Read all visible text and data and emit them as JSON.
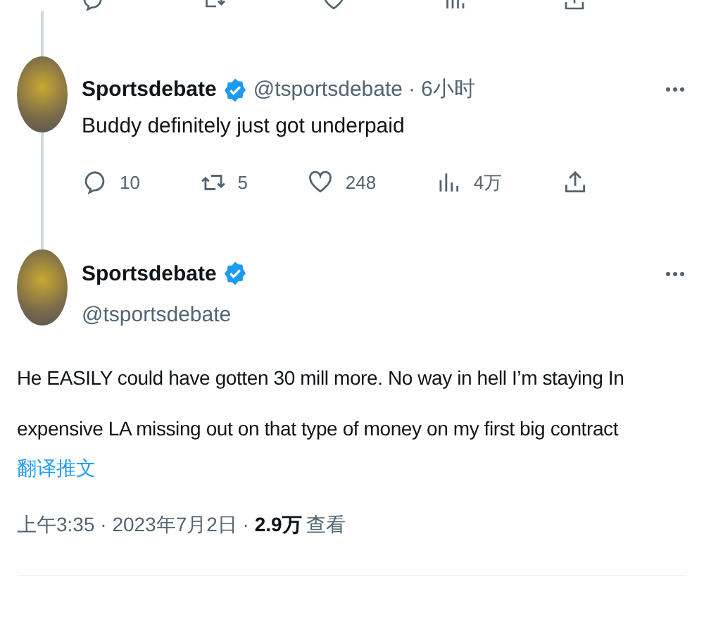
{
  "reply": {
    "name": "Sportsdebate",
    "verified": true,
    "handle": "@tsportsdebate",
    "separator": "·",
    "time": "6小时",
    "text": "Buddy definitely just got underpaid",
    "actions": [
      {
        "kind": "reply",
        "count": "10"
      },
      {
        "kind": "retweet",
        "count": "5"
      },
      {
        "kind": "like",
        "count": "248"
      },
      {
        "kind": "views",
        "count": "4万"
      },
      {
        "kind": "share"
      }
    ]
  },
  "tweet": {
    "name": "Sportsdebate",
    "verified": true,
    "handle": "@tsportsdebate",
    "text": "He EASILY could have gotten 30 mill more. No way in hell I’m staying In expensive LA missing out on that type of money on my first big contract",
    "translate": "翻译推文",
    "time": "上午3:35 · 2023年7月2日 · ",
    "views": "2.9万",
    "views_label": "查看"
  }
}
